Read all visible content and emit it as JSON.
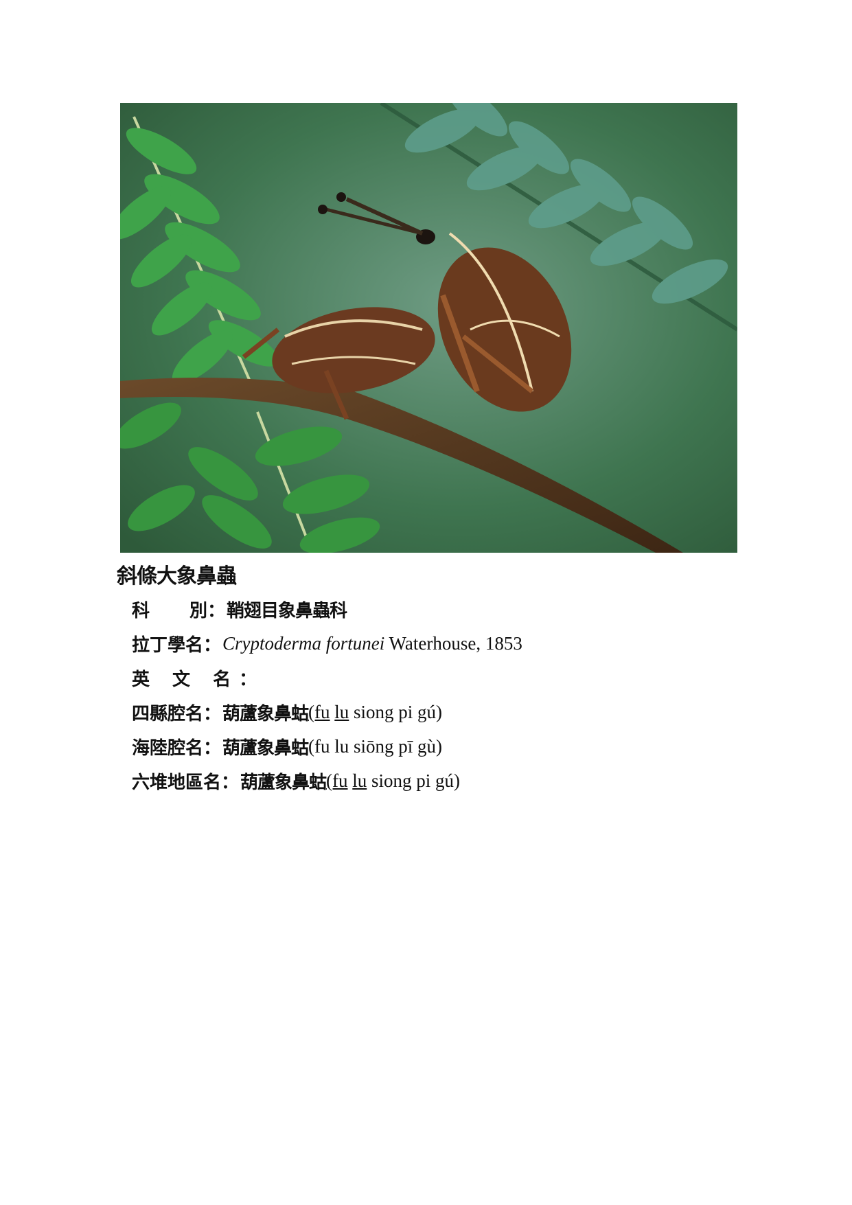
{
  "photo": {
    "subject": "two weevils on a fern stalk"
  },
  "title": "斜條大象鼻蟲",
  "fields": {
    "family": {
      "label_a": "科",
      "label_b": "別",
      "colon": "：",
      "value": "鞘翅目象鼻蟲科"
    },
    "latin": {
      "label": "拉丁學名",
      "colon": "：",
      "genus_species": "Cryptoderma fortunei",
      "author": " Waterhouse, 1853"
    },
    "english": {
      "label": "英 文 名",
      "colon": "：",
      "value": ""
    },
    "sixian": {
      "label": "四縣腔名",
      "colon": "：",
      "value": "葫蘆象鼻蛄",
      "r1": "(fu",
      "r2": " ",
      "r3": "lu",
      "r4": " siong pi gú)"
    },
    "hailu": {
      "label": "海陸腔名",
      "colon": "：",
      "value": "葫蘆象鼻蛄",
      "roman": "(fu lu siōng pī gù)"
    },
    "liudui": {
      "label": "六堆地區名",
      "colon": "：",
      "value": "葫蘆象鼻蛄",
      "r1": "(fu",
      "r2": " ",
      "r3": "lu",
      "r4": " siong pi gú)"
    }
  }
}
